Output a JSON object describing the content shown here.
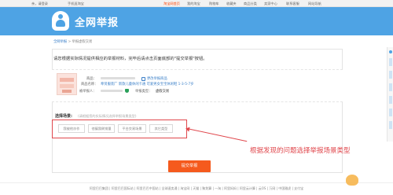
{
  "topbar": {
    "links": [
      "亲，请登录",
      "手机逛淘宝",
      "淘宝网首页",
      "我的淘宝",
      "购物车",
      "收藏夹",
      "商品分类",
      "卖家中心",
      "联系客服",
      "网站导航"
    ]
  },
  "banner": {
    "title": "全网举报"
  },
  "breadcrumb": {
    "home": "全网举报",
    "sep": ">",
    "current": "举报虚假交易"
  },
  "instruction": "请您根据实际情况提供相应的举报材料，完毕后请点击页面底部的\"提交举报\"按钮。",
  "product": {
    "label_goods": "商品：",
    "label_name": "商品名称：",
    "name": "奉贤服装厂 新款儿童休闲卡通 可爱男女宝宝休闲鞋 1-3-5-7岁",
    "label_seller": "被举报人：",
    "change_link": "更改举报商品",
    "report_type_label": "举报类型：",
    "report_type": "虚假交易"
  },
  "scenario": {
    "label": "选择场景:",
    "hint": "(请根据您的实际情况选择举报场景类型)",
    "options": [
      "我被他炒作",
      "他骗我刷销量",
      "平台交易场景",
      "其它类型"
    ]
  },
  "annotation": "根据发现的问题选择举报场景类型",
  "submit_label": "提交举报",
  "footer": "阿里巴巴集团 | 阿里巴巴国际站 | 阿里巴巴中国站 | 全球速卖通 | 淘宝网 | 天猫 | 聚划算 | 一淘 | 阿里妈妈 | 阿里云计算 | 云OS | 万网 | 中国雅虎 | 支付宝",
  "colors": {
    "banner": "#4ea3e4",
    "accent": "#f55a1d",
    "annotation": "#e0474c",
    "link": "#3a7fc8"
  }
}
